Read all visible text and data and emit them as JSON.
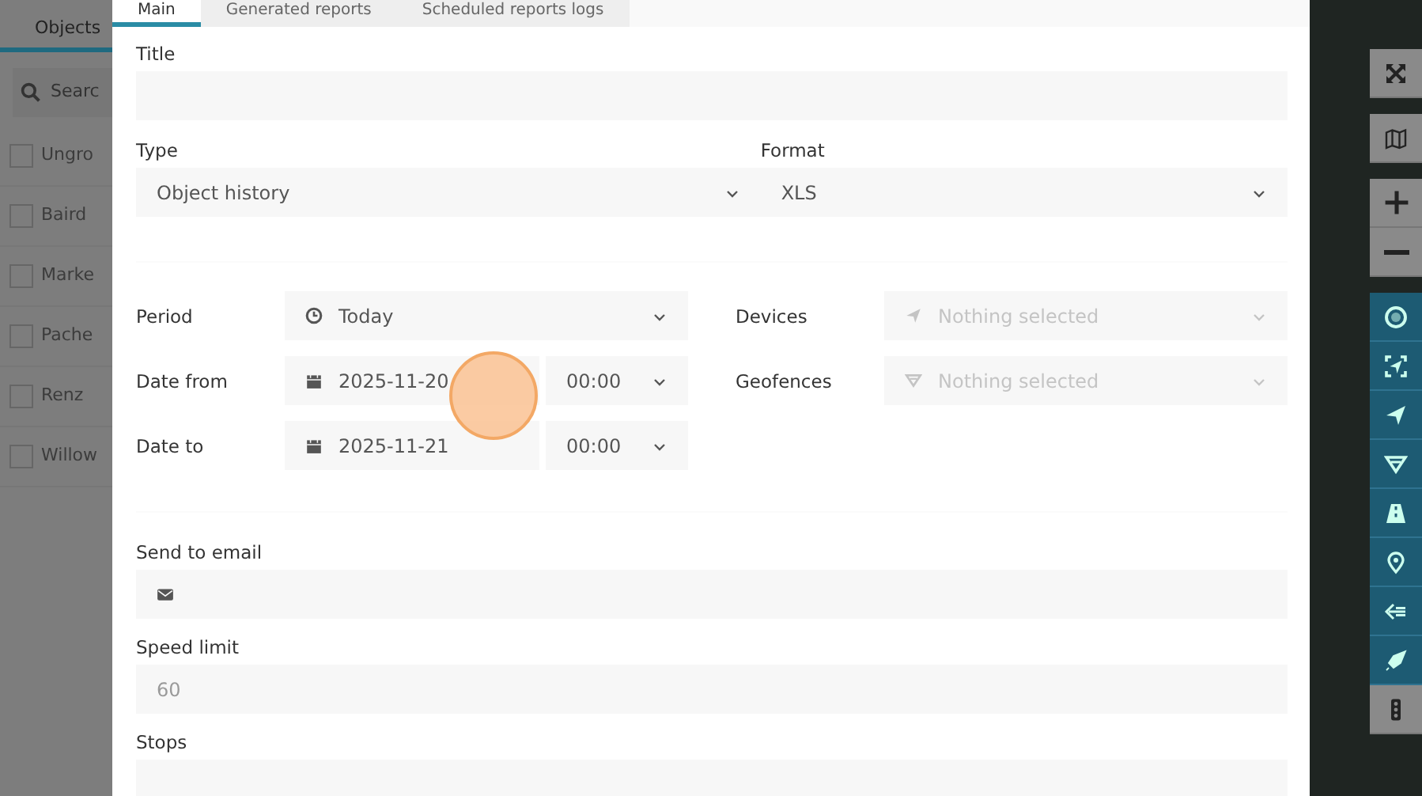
{
  "sidebar": {
    "tab": "Objects",
    "search_placeholder": "Searc",
    "items": [
      {
        "label": "Ungro",
        "checked": false
      },
      {
        "label": "Baird",
        "checked": false
      },
      {
        "label": "Marke",
        "checked": false
      },
      {
        "label": "Pache",
        "checked": false
      },
      {
        "label": "Renz",
        "checked": false
      },
      {
        "label": "Willow",
        "checked": false
      }
    ]
  },
  "dialog": {
    "tabs": [
      {
        "label": "Main",
        "selected": true
      },
      {
        "label": "Generated reports",
        "selected": false
      },
      {
        "label": "Scheduled reports logs",
        "selected": false
      }
    ],
    "title_field": {
      "label": "Title"
    },
    "type_field": {
      "label": "Type",
      "value": "Object history"
    },
    "format_field": {
      "label": "Format",
      "value": "XLS"
    },
    "period": {
      "label": "Period",
      "value": "Today"
    },
    "date_from": {
      "label": "Date from",
      "date": "2025-11-20",
      "time": "00:00"
    },
    "date_to": {
      "label": "Date to",
      "date": "2025-11-21",
      "time": "00:00"
    },
    "devices": {
      "label": "Devices",
      "placeholder": "Nothing selected"
    },
    "geofences": {
      "label": "Geofences",
      "placeholder": "Nothing selected"
    },
    "send_to_email": {
      "label": "Send to email"
    },
    "speed_limit": {
      "label": "Speed limit",
      "placeholder": "60"
    },
    "stops": {
      "label": "Stops"
    }
  }
}
